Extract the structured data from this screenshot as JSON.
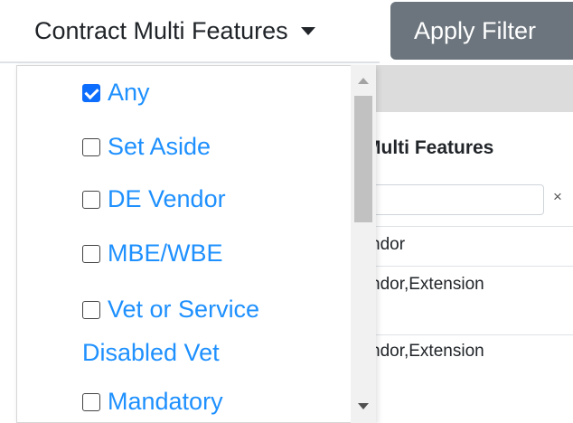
{
  "topbar": {
    "dropdown_label": "Contract Multi Features",
    "apply_label": "Apply Filter"
  },
  "dropdown": {
    "options": [
      {
        "label": "Any",
        "checked": true
      },
      {
        "label": "Set Aside",
        "checked": false
      },
      {
        "label": "DE Vendor",
        "checked": false
      },
      {
        "label": "MBE/WBE",
        "checked": false
      },
      {
        "label": "Vet or Service",
        "label_line2": "Disabled Vet",
        "checked": false
      },
      {
        "label": "Mandatory",
        "checked": false
      }
    ]
  },
  "table": {
    "column_header": "Multi Features",
    "clear_symbol": "×",
    "rows": [
      "ndor",
      "ndor,Extension",
      "ndor,Extension"
    ]
  },
  "colors": {
    "link": "#1e90ff",
    "checkbox_checked": "#0d6efd",
    "apply_button": "#6c757d"
  },
  "icons": [
    "caret-down-icon",
    "checkbox-checked-icon",
    "checkbox-unchecked-icon",
    "scroll-up-icon",
    "scroll-down-icon",
    "clear-icon"
  ]
}
